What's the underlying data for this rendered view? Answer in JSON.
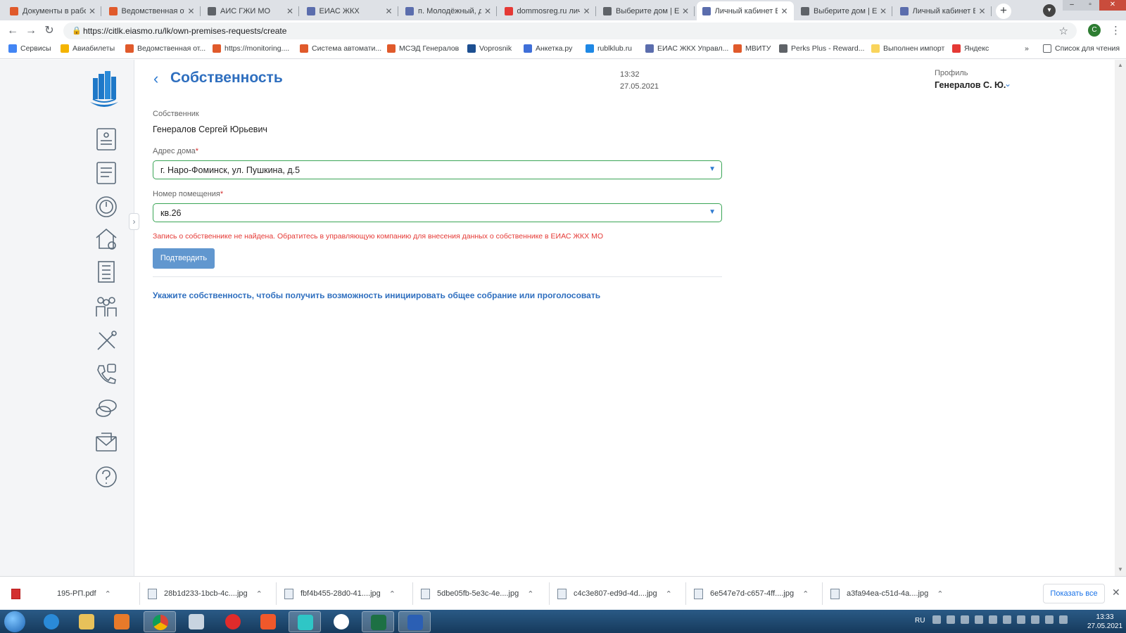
{
  "browser": {
    "tabs": [
      {
        "title": "Документы в рабо",
        "color": "#e05a2b"
      },
      {
        "title": "Ведомственная отч",
        "color": "#e05a2b"
      },
      {
        "title": "АИС ГЖИ МО",
        "color": "#5f6368"
      },
      {
        "title": "ЕИАС ЖКХ",
        "color": "#5b6dad"
      },
      {
        "title": "п. Молодёжный, д",
        "color": "#5b6dad"
      },
      {
        "title": "dommosreg.ru лич",
        "color": "#e53935"
      },
      {
        "title": "Выберите дом | ЕИ",
        "color": "#5f6368"
      },
      {
        "title": "Личный кабинет Е",
        "color": "#5b6dad"
      },
      {
        "title": "Выберите дом | ЕИ",
        "color": "#5f6368"
      },
      {
        "title": "Личный кабинет Е",
        "color": "#5b6dad"
      }
    ],
    "active_tab_index": 7,
    "url": "https://citlk.eiasmo.ru/lk/own-premises-requests/create",
    "account_initial": "С",
    "bookmarks": [
      {
        "label": "Сервисы",
        "color": "#4285f4"
      },
      {
        "label": "Авиабилеты",
        "color": "#f4b400"
      },
      {
        "label": "Ведомственная от...",
        "color": "#e05a2b"
      },
      {
        "label": "https://monitoring....",
        "color": "#e05a2b"
      },
      {
        "label": "Система автомати...",
        "color": "#e05a2b"
      },
      {
        "label": "МСЭД Генералов",
        "color": "#e05a2b"
      },
      {
        "label": "Voprosnik",
        "color": "#1d4f91"
      },
      {
        "label": "Анкетка.ру",
        "color": "#3f6fd8"
      },
      {
        "label": "rublklub.ru",
        "color": "#1e88e5"
      },
      {
        "label": "ЕИАС ЖКХ Управл...",
        "color": "#5b6dad"
      },
      {
        "label": "МВИТУ",
        "color": "#e05a2b"
      },
      {
        "label": "Perks Plus - Reward...",
        "color": "#5f6368"
      },
      {
        "label": "Выполнен импорт",
        "color": "#f9d45c"
      },
      {
        "label": "Яндекс",
        "color": "#e53935"
      }
    ],
    "bookmarks_overflow": "»",
    "reading_list": "Список для чтения"
  },
  "page": {
    "title": "Собственность",
    "time": "13:32",
    "date": "27.05.2021",
    "profile_label": "Профиль",
    "profile_name": "Генералов С. Ю.",
    "owner_label": "Собственник",
    "owner_value": "Генералов Сергей Юрьевич",
    "address_label": "Адрес дома",
    "address_value": "г. Наро-Фоминск, ул. Пушкина, д.5",
    "room_label": "Номер помещения",
    "room_value": "кв.26",
    "required_mark": "*",
    "error_text": "Запись о собственнике не найдена. Обратитесь в управляющую компанию для внесения данных о собственнике в ЕИАС ЖКХ МО",
    "confirm_label": "Подтвердить",
    "hint_text": "Укажите собственность, чтобы получить возможность инициировать общее собрание или проголосовать"
  },
  "sidebar": {
    "icons": [
      "document-icon",
      "list-icon",
      "meter-icon",
      "house-info-icon",
      "building-icon",
      "people-icon",
      "tools-icon",
      "phone-help-icon",
      "chat-icon",
      "mail-icon",
      "help-icon"
    ],
    "accent": "#1e78c8",
    "icon_color": "#5b6b7a"
  },
  "downloads": {
    "items": [
      "195-РП.pdf",
      "28b1d233-1bcb-4c....jpg",
      "fbf4b455-28d0-41....jpg",
      "5dbe05fb-5e3c-4e....jpg",
      "c4c3e807-ed9d-4d....jpg",
      "6e547e7d-c657-4ff....jpg",
      "a3fa94ea-c51d-4a....jpg"
    ],
    "show_all": "Показать все"
  },
  "taskbar": {
    "lang": "RU",
    "time": "13:33",
    "date": "27.05.2021"
  }
}
